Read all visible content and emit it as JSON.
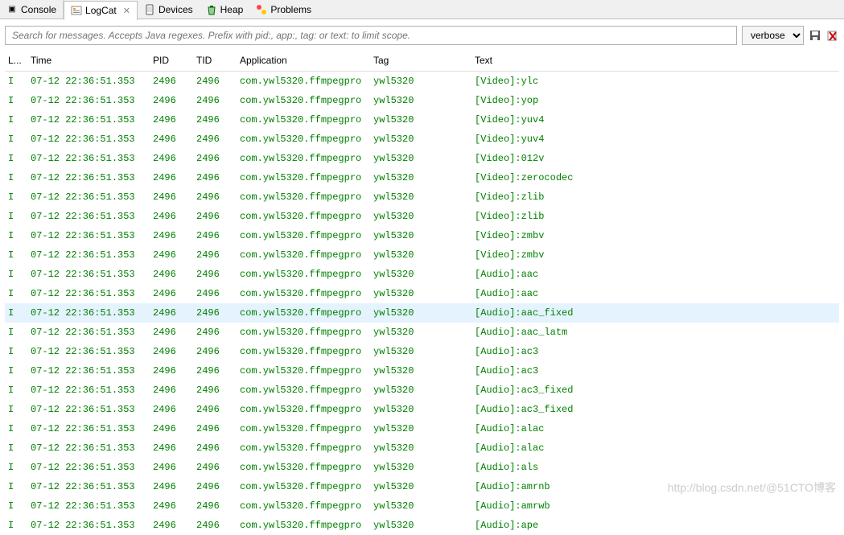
{
  "tabs": [
    {
      "label": "Console",
      "icon": "📟"
    },
    {
      "label": "LogCat",
      "icon": "📋",
      "active": true,
      "closable": true
    },
    {
      "label": "Devices",
      "icon": "📱"
    },
    {
      "label": "Heap",
      "icon": "🗑"
    },
    {
      "label": "Problems",
      "icon": "⚠"
    }
  ],
  "search": {
    "placeholder": "Search for messages. Accepts Java regexes. Prefix with pid:, app:, tag: or text: to limit scope.",
    "level": "verbose"
  },
  "columns": {
    "level": "L...",
    "time": "Time",
    "pid": "PID",
    "tid": "TID",
    "app": "Application",
    "tag": "Tag",
    "text": "Text"
  },
  "rows": [
    {
      "l": "I",
      "time": "07-12 22:36:51.353",
      "pid": "2496",
      "tid": "2496",
      "app": "com.ywl5320.ffmpegpro",
      "tag": "ywl5320",
      "text": "[Video]:ylc"
    },
    {
      "l": "I",
      "time": "07-12 22:36:51.353",
      "pid": "2496",
      "tid": "2496",
      "app": "com.ywl5320.ffmpegpro",
      "tag": "ywl5320",
      "text": "[Video]:yop"
    },
    {
      "l": "I",
      "time": "07-12 22:36:51.353",
      "pid": "2496",
      "tid": "2496",
      "app": "com.ywl5320.ffmpegpro",
      "tag": "ywl5320",
      "text": "[Video]:yuv4"
    },
    {
      "l": "I",
      "time": "07-12 22:36:51.353",
      "pid": "2496",
      "tid": "2496",
      "app": "com.ywl5320.ffmpegpro",
      "tag": "ywl5320",
      "text": "[Video]:yuv4"
    },
    {
      "l": "I",
      "time": "07-12 22:36:51.353",
      "pid": "2496",
      "tid": "2496",
      "app": "com.ywl5320.ffmpegpro",
      "tag": "ywl5320",
      "text": "[Video]:012v"
    },
    {
      "l": "I",
      "time": "07-12 22:36:51.353",
      "pid": "2496",
      "tid": "2496",
      "app": "com.ywl5320.ffmpegpro",
      "tag": "ywl5320",
      "text": "[Video]:zerocodec"
    },
    {
      "l": "I",
      "time": "07-12 22:36:51.353",
      "pid": "2496",
      "tid": "2496",
      "app": "com.ywl5320.ffmpegpro",
      "tag": "ywl5320",
      "text": "[Video]:zlib"
    },
    {
      "l": "I",
      "time": "07-12 22:36:51.353",
      "pid": "2496",
      "tid": "2496",
      "app": "com.ywl5320.ffmpegpro",
      "tag": "ywl5320",
      "text": "[Video]:zlib"
    },
    {
      "l": "I",
      "time": "07-12 22:36:51.353",
      "pid": "2496",
      "tid": "2496",
      "app": "com.ywl5320.ffmpegpro",
      "tag": "ywl5320",
      "text": "[Video]:zmbv"
    },
    {
      "l": "I",
      "time": "07-12 22:36:51.353",
      "pid": "2496",
      "tid": "2496",
      "app": "com.ywl5320.ffmpegpro",
      "tag": "ywl5320",
      "text": "[Video]:zmbv"
    },
    {
      "l": "I",
      "time": "07-12 22:36:51.353",
      "pid": "2496",
      "tid": "2496",
      "app": "com.ywl5320.ffmpegpro",
      "tag": "ywl5320",
      "text": "[Audio]:aac"
    },
    {
      "l": "I",
      "time": "07-12 22:36:51.353",
      "pid": "2496",
      "tid": "2496",
      "app": "com.ywl5320.ffmpegpro",
      "tag": "ywl5320",
      "text": "[Audio]:aac"
    },
    {
      "l": "I",
      "time": "07-12 22:36:51.353",
      "pid": "2496",
      "tid": "2496",
      "app": "com.ywl5320.ffmpegpro",
      "tag": "ywl5320",
      "text": "[Audio]:aac_fixed",
      "selected": true
    },
    {
      "l": "I",
      "time": "07-12 22:36:51.353",
      "pid": "2496",
      "tid": "2496",
      "app": "com.ywl5320.ffmpegpro",
      "tag": "ywl5320",
      "text": "[Audio]:aac_latm"
    },
    {
      "l": "I",
      "time": "07-12 22:36:51.353",
      "pid": "2496",
      "tid": "2496",
      "app": "com.ywl5320.ffmpegpro",
      "tag": "ywl5320",
      "text": "[Audio]:ac3"
    },
    {
      "l": "I",
      "time": "07-12 22:36:51.353",
      "pid": "2496",
      "tid": "2496",
      "app": "com.ywl5320.ffmpegpro",
      "tag": "ywl5320",
      "text": "[Audio]:ac3"
    },
    {
      "l": "I",
      "time": "07-12 22:36:51.353",
      "pid": "2496",
      "tid": "2496",
      "app": "com.ywl5320.ffmpegpro",
      "tag": "ywl5320",
      "text": "[Audio]:ac3_fixed"
    },
    {
      "l": "I",
      "time": "07-12 22:36:51.353",
      "pid": "2496",
      "tid": "2496",
      "app": "com.ywl5320.ffmpegpro",
      "tag": "ywl5320",
      "text": "[Audio]:ac3_fixed"
    },
    {
      "l": "I",
      "time": "07-12 22:36:51.353",
      "pid": "2496",
      "tid": "2496",
      "app": "com.ywl5320.ffmpegpro",
      "tag": "ywl5320",
      "text": "[Audio]:alac"
    },
    {
      "l": "I",
      "time": "07-12 22:36:51.353",
      "pid": "2496",
      "tid": "2496",
      "app": "com.ywl5320.ffmpegpro",
      "tag": "ywl5320",
      "text": "[Audio]:alac"
    },
    {
      "l": "I",
      "time": "07-12 22:36:51.353",
      "pid": "2496",
      "tid": "2496",
      "app": "com.ywl5320.ffmpegpro",
      "tag": "ywl5320",
      "text": "[Audio]:als"
    },
    {
      "l": "I",
      "time": "07-12 22:36:51.353",
      "pid": "2496",
      "tid": "2496",
      "app": "com.ywl5320.ffmpegpro",
      "tag": "ywl5320",
      "text": "[Audio]:amrnb"
    },
    {
      "l": "I",
      "time": "07-12 22:36:51.353",
      "pid": "2496",
      "tid": "2496",
      "app": "com.ywl5320.ffmpegpro",
      "tag": "ywl5320",
      "text": "[Audio]:amrwb"
    },
    {
      "l": "I",
      "time": "07-12 22:36:51.353",
      "pid": "2496",
      "tid": "2496",
      "app": "com.ywl5320.ffmpegpro",
      "tag": "ywl5320",
      "text": "[Audio]:ape"
    }
  ],
  "watermark": "http://blog.csdn.net/@51CTO博客"
}
